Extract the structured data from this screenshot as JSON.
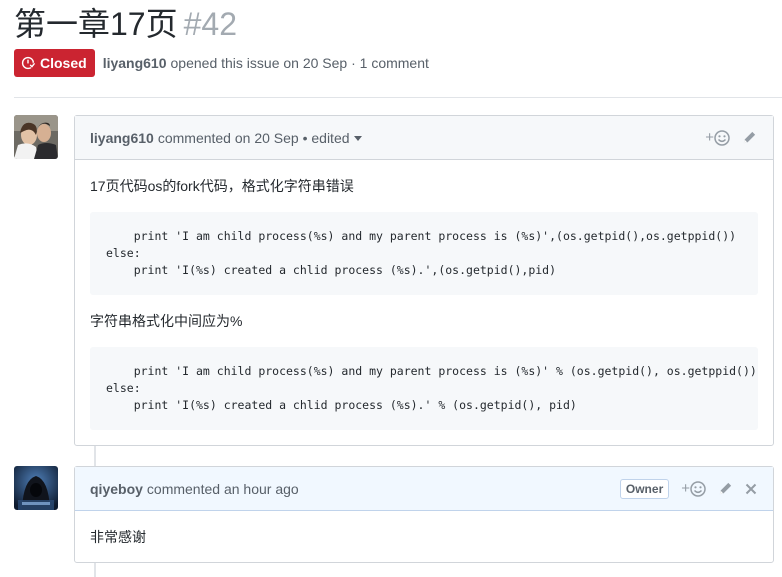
{
  "issue": {
    "title": "第一章17页",
    "number": "#42",
    "state": "Closed",
    "state_color": "#cb2431",
    "author": "liyang610",
    "opened_text": "opened this issue on 20 Sep · 1 comment"
  },
  "comments": [
    {
      "author": "liyang610",
      "meta": "commented on 20 Sep • edited",
      "avatar_icon": "user-photo-avatar",
      "body_text_1": "17页代码os的fork代码，格式化字符串错误",
      "code_1": "    print 'I am child process(%s) and my parent process is (%s)',(os.getpid(),os.getppid())\nelse:\n    print 'I(%s) created a chlid process (%s).',(os.getpid(),pid)",
      "body_text_2": "字符串格式化中间应为%",
      "code_2": "    print 'I am child process(%s) and my parent process is (%s)' % (os.getpid(), os.getppid())\nelse:\n    print 'I(%s) created a chlid process (%s).' % (os.getpid(), pid)"
    },
    {
      "author": "qiyeboy",
      "meta": "commented an hour ago",
      "badge": "Owner",
      "avatar_icon": "hooded-figure-avatar",
      "body_text": "非常感谢"
    }
  ],
  "icons": {
    "closed_state": "issue-closed-icon",
    "reaction": "smiley-icon",
    "edit": "pencil-icon",
    "delete": "close-icon"
  },
  "colors": {
    "closed": "#cb2431",
    "owner_header": "#f1f8ff",
    "gray_header": "#f6f8fa"
  }
}
